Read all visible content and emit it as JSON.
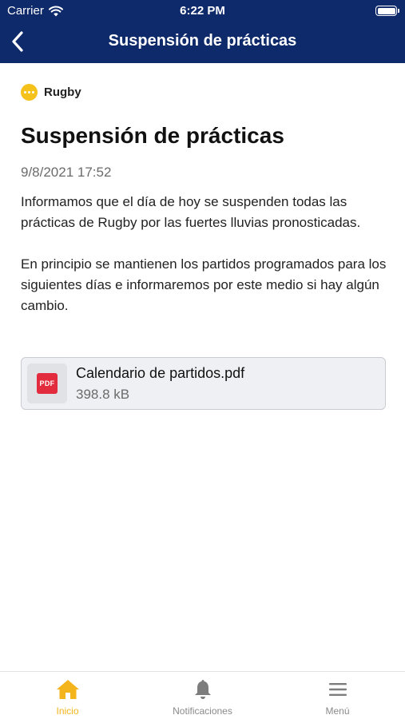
{
  "status_bar": {
    "carrier": "Carrier",
    "time": "6:22 PM"
  },
  "nav": {
    "title": "Suspensión de prácticas"
  },
  "post": {
    "category": "Rugby",
    "category_color": "#f5c21b",
    "title": "Suspensión de prácticas",
    "date": "9/8/2021 17:52",
    "paragraphs": [
      "Informamos que el día de hoy se suspenden todas las prácticas de Rugby por las fuertes lluvias pronosticadas.",
      "En principio se mantienen los partidos programados para los siguientes días e informaremos por este medio si hay algún cambio."
    ],
    "attachment": {
      "icon_text": "PDF",
      "name": "Calendario de partidos.pdf",
      "size": "398.8 kB"
    }
  },
  "tabbar": {
    "items": [
      {
        "label": "Inicio",
        "icon": "home-icon",
        "active": true
      },
      {
        "label": "Notificaciones",
        "icon": "bell-icon",
        "active": false
      },
      {
        "label": "Menú",
        "icon": "menu-icon",
        "active": false
      }
    ]
  },
  "colors": {
    "header": "#0f2a6b",
    "accent": "#f3b51b",
    "pdf": "#e22b3c"
  }
}
